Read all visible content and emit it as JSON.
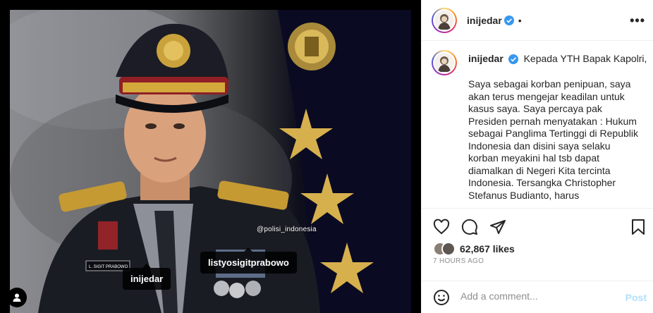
{
  "post": {
    "username": "inijedar",
    "header_separator": "•",
    "more_label": "•••",
    "caption_first_line": "Kepada YTH Bapak Kapolri,",
    "caption_body": "Saya sebagai korban penipuan, saya akan terus mengejar keadilan untuk kasus saya. Saya percaya pak Presiden pernah menyatakan : Hukum sebagai Panglima Tertinggi di Republik Indonesia dan disini saya selaku korban meyakini hal tsb dapat diamalkan di Negeri Kita tercinta Indonesia. Tersangka Christopher Stefanus Budianto, harus",
    "likes": "62,867 likes",
    "timestamp": "7 HOURS AGO"
  },
  "media": {
    "watermark": "@polisi_indonesia",
    "tags": {
      "owner": "inijedar",
      "person": "listyosigitprabowo"
    },
    "nameplate": "L. SIGIT PRABOWO"
  },
  "comment": {
    "placeholder": "Add a comment...",
    "post_label": "Post"
  },
  "icons": {
    "more": "more-horizontal-icon",
    "verified": "verified-badge-icon",
    "like": "heart-icon",
    "comment": "comment-bubble-icon",
    "share": "paper-plane-icon",
    "save": "bookmark-icon",
    "emoji": "emoji-smile-icon",
    "user_tags": "person-icon"
  },
  "colors": {
    "verified": "#3897f0",
    "post_button": "#b2dffc",
    "muted": "#8e8e8e"
  }
}
